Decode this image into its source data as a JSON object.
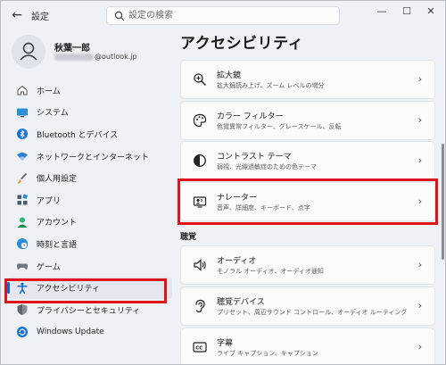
{
  "window": {
    "app_title": "設定",
    "back_glyph": "←",
    "minimize_glyph": "—",
    "maximize_glyph": "☐",
    "close_glyph": "✕"
  },
  "search": {
    "placeholder": "設定の検索"
  },
  "user": {
    "name": "秋葉一郎",
    "email_suffix": "@outlook.jp"
  },
  "sidebar": {
    "items": [
      {
        "label": "ホーム",
        "icon": "home-icon"
      },
      {
        "label": "システム",
        "icon": "monitor-icon"
      },
      {
        "label": "Bluetooth とデバイス",
        "icon": "bluetooth-icon"
      },
      {
        "label": "ネットワークとインターネット",
        "icon": "wifi-icon"
      },
      {
        "label": "個人用設定",
        "icon": "brush-icon"
      },
      {
        "label": "アプリ",
        "icon": "apps-icon"
      },
      {
        "label": "アカウント",
        "icon": "account-icon"
      },
      {
        "label": "時刻と言語",
        "icon": "globe-clock-icon"
      },
      {
        "label": "ゲーム",
        "icon": "gamepad-icon"
      },
      {
        "label": "アクセシビリティ",
        "icon": "accessibility-icon",
        "active": true
      },
      {
        "label": "プライバシーとセキュリティ",
        "icon": "shield-icon"
      },
      {
        "label": "Windows Update",
        "icon": "update-icon"
      }
    ]
  },
  "main": {
    "page_title": "アクセシビリティ",
    "cards": [
      {
        "title": "拡大鏡",
        "desc": "拡大鏡読み上げ、ズーム レベルの増分",
        "icon": "magnifier-icon"
      },
      {
        "title": "カラー フィルター",
        "desc": "色覚異常フィルター、グレースケール、反転",
        "icon": "palette-icon"
      },
      {
        "title": "コントラスト テーマ",
        "desc": "弱視、光線過敏症のための色テーマ",
        "icon": "contrast-icon"
      },
      {
        "title": "ナレーター",
        "desc": "音声、詳細度、キーボード、点字",
        "icon": "narrator-icon"
      }
    ],
    "section_hearing": "聴覚",
    "hearing_cards": [
      {
        "title": "オーディオ",
        "desc": "モノラル オーディオ、オーディオ通知",
        "icon": "speaker-icon"
      },
      {
        "title": "聴覚デバイス",
        "desc": "プリセット、周辺サウンド コントロール、オーディオ ルーティング",
        "icon": "ear-icon"
      },
      {
        "title": "字幕",
        "desc": "ライブ キャプション、キャプション",
        "icon": "caption-icon"
      }
    ],
    "chevron": "›"
  },
  "colors": {
    "accent": "#1168c7",
    "highlight": "#e0131b",
    "background": "#eef1f6",
    "card": "#fbfbfc"
  }
}
